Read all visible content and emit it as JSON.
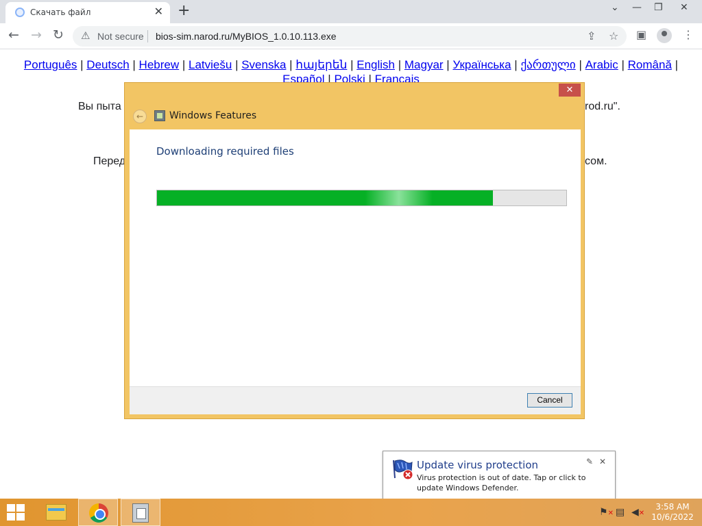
{
  "browser": {
    "tab_title": "Скачать файл",
    "new_tab": "+",
    "window_controls": [
      "⌄",
      "—",
      "❐",
      "✕"
    ],
    "security_label": "Not secure",
    "url": "bios-sim.narod.ru/MyBIOS_1.0.10.113.exe"
  },
  "page": {
    "languages": [
      "Português",
      "Deutsch",
      "Hebrew",
      "Latviešu",
      "Svenska",
      "հայերեն",
      "English",
      "Magyar",
      "Українська",
      "ქართული",
      "Arabic",
      "Română",
      "Español",
      "Polski",
      "Français"
    ],
    "line1_left": "Вы пыта",
    "line1_right": "rod.ru\".",
    "line2_left": "Перед",
    "line2_right": "сом."
  },
  "dialog": {
    "title": "Windows Features",
    "heading": "Downloading required files",
    "progress_fraction": 0.82,
    "cancel_label": "Cancel",
    "close_glyph": "✕"
  },
  "notification": {
    "title": "Update virus protection",
    "message": "Virus protection is out of date. Tap or click to update Windows Defender.",
    "pin_glyph": "✎",
    "close_glyph": "✕"
  },
  "taskbar": {
    "time": "3:58 AM",
    "date": "10/6/2022",
    "accent_color": "#e39a37"
  }
}
